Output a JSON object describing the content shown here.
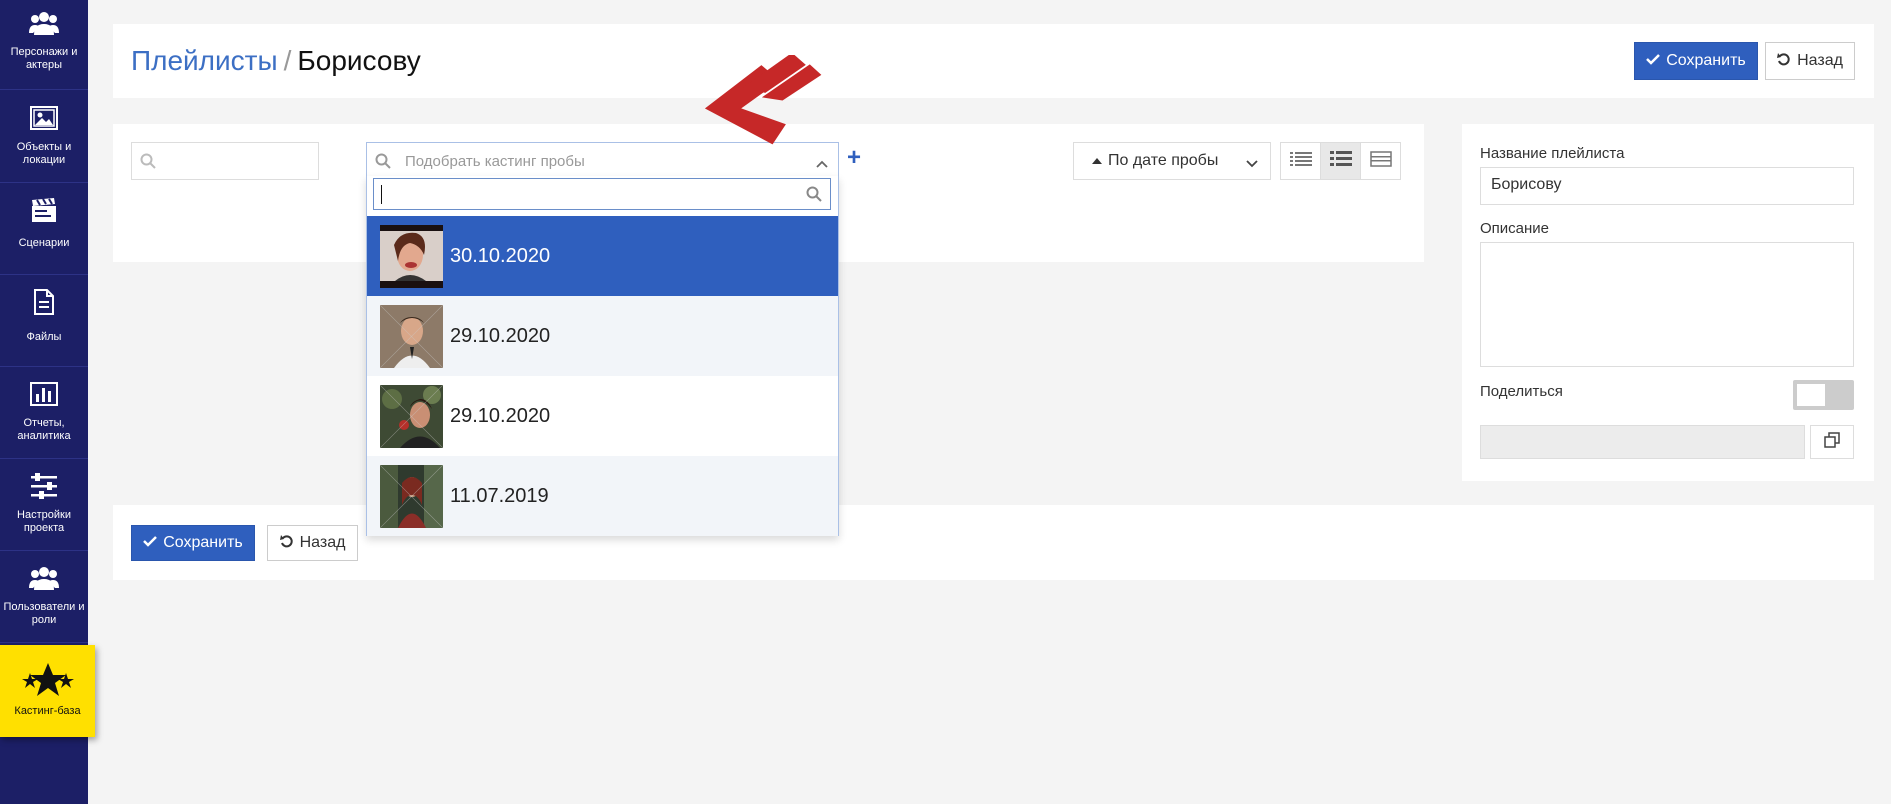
{
  "sidebar": {
    "items": [
      {
        "label": "Персонажи и актеры",
        "icon": "users-icon"
      },
      {
        "label": "Объекты и локации",
        "icon": "image-icon"
      },
      {
        "label": "Сценарии",
        "icon": "clapperboard-icon"
      },
      {
        "label": "Файлы",
        "icon": "file-icon"
      },
      {
        "label": "Отчеты, аналитика",
        "icon": "bar-chart-icon"
      },
      {
        "label": "Настройки проекта",
        "icon": "sliders-icon"
      },
      {
        "label": "Пользователи и роли",
        "icon": "users-icon"
      },
      {
        "label": "Кастинг-база",
        "icon": "stars-icon",
        "active": true
      }
    ]
  },
  "header": {
    "breadcrumb_parent": "Плейлисты",
    "breadcrumb_separator": "/",
    "breadcrumb_current": "Борисову",
    "save_label": "Сохранить",
    "back_label": "Назад"
  },
  "filters": {
    "search_placeholder": "",
    "casting_placeholder": "Подобрать кастинг пробы",
    "add_symbol": "+",
    "sort_label": "По дате пробы"
  },
  "dropdown": {
    "search_value": "",
    "options": [
      {
        "label": "30.10.2020",
        "selected": true
      },
      {
        "label": "29.10.2020",
        "selected": false
      },
      {
        "label": "29.10.2020",
        "selected": false
      },
      {
        "label": "11.07.2019",
        "selected": false
      }
    ]
  },
  "footer": {
    "save_label": "Сохранить",
    "back_label": "Назад"
  },
  "right_panel": {
    "name_label": "Название плейлиста",
    "name_value": "Борисову",
    "description_label": "Описание",
    "description_value": "",
    "share_label": "Поделиться",
    "share_enabled": false,
    "share_link": ""
  },
  "colors": {
    "sidebar_bg": "#1c1f66",
    "accent": "#2f5fbe",
    "active_nav": "#ffe000",
    "annotation_arrow": "#c62828"
  }
}
